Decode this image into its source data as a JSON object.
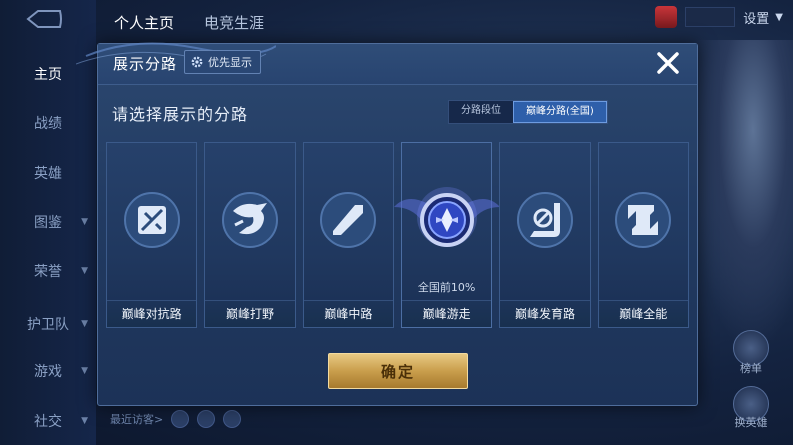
{
  "app": {
    "top_tabs": [
      "个人主页",
      "电竞生涯"
    ],
    "settings_label": "设置",
    "sidebar": [
      {
        "label": "主页",
        "active": true
      },
      {
        "label": "战绩"
      },
      {
        "label": "英雄"
      },
      {
        "label": "图鉴"
      },
      {
        "label": "荣誉"
      },
      {
        "label": "护卫队"
      },
      {
        "label": "游戏"
      },
      {
        "label": "社交"
      }
    ],
    "recent_visitors": "最近访客>",
    "right_labels": [
      "榜单",
      "换英雄"
    ]
  },
  "modal": {
    "title": "展示分路",
    "priority_button": "优先显示",
    "prompt": "请选择展示的分路",
    "tabs": [
      {
        "label": "分路段位",
        "active": false
      },
      {
        "label": "巅峰分路(全国)",
        "active": true
      }
    ],
    "cards": [
      {
        "label": "巅峰对抗路",
        "icon": "clash-lane-icon",
        "selected": false,
        "rank": ""
      },
      {
        "label": "巅峰打野",
        "icon": "jungle-icon",
        "selected": false,
        "rank": ""
      },
      {
        "label": "巅峰中路",
        "icon": "mid-lane-icon",
        "selected": false,
        "rank": ""
      },
      {
        "label": "巅峰游走",
        "icon": "roam-badge-icon",
        "selected": true,
        "rank": "全国前10%"
      },
      {
        "label": "巅峰发育路",
        "icon": "farm-lane-icon",
        "selected": false,
        "rank": ""
      },
      {
        "label": "巅峰全能",
        "icon": "all-round-icon",
        "selected": false,
        "rank": ""
      }
    ],
    "confirm_label": "确定",
    "colors": {
      "accent_gold": "#c99e4c",
      "tab_active": "#2e5faa",
      "panel": "#223b62"
    }
  }
}
